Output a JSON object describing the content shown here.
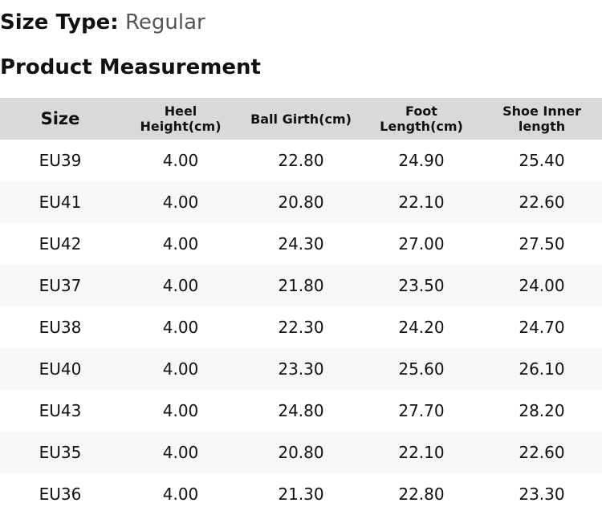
{
  "size_type": {
    "label": "Size Type:",
    "value": "Regular"
  },
  "section_title": "Product Measurement",
  "table": {
    "headers": [
      "Size",
      "Heel Height(cm)",
      "Ball Girth(cm)",
      "Foot Length(cm)",
      "Shoe Inner length"
    ],
    "rows": [
      [
        "EU39",
        "4.00",
        "22.80",
        "24.90",
        "25.40"
      ],
      [
        "EU41",
        "4.00",
        "20.80",
        "22.10",
        "22.60"
      ],
      [
        "EU42",
        "4.00",
        "24.30",
        "27.00",
        "27.50"
      ],
      [
        "EU37",
        "4.00",
        "21.80",
        "23.50",
        "24.00"
      ],
      [
        "EU38",
        "4.00",
        "22.30",
        "24.20",
        "24.70"
      ],
      [
        "EU40",
        "4.00",
        "23.30",
        "25.60",
        "26.10"
      ],
      [
        "EU43",
        "4.00",
        "24.80",
        "27.70",
        "28.20"
      ],
      [
        "EU35",
        "4.00",
        "20.80",
        "22.10",
        "22.60"
      ],
      [
        "EU36",
        "4.00",
        "21.30",
        "22.80",
        "23.30"
      ]
    ]
  }
}
